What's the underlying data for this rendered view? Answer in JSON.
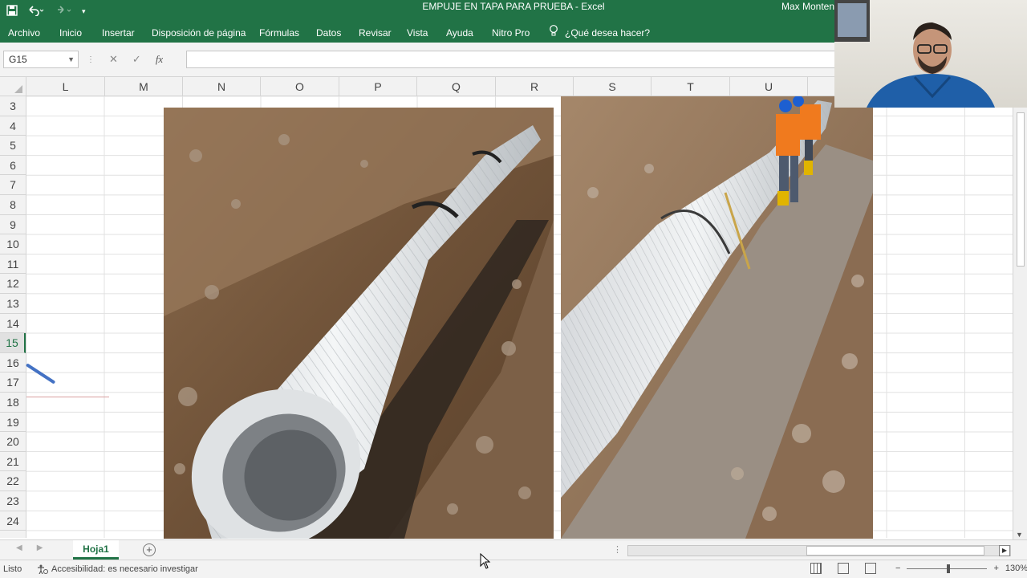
{
  "window": {
    "title": "EMPUJE EN TAPA PARA PRUEBA  -  Excel",
    "user": "Max Monten"
  },
  "ribbon": {
    "tabs": [
      "Archivo",
      "Inicio",
      "Insertar",
      "Disposición de página",
      "Fórmulas",
      "Datos",
      "Revisar",
      "Vista",
      "Ayuda",
      "Nitro Pro"
    ],
    "tell_me": "¿Qué desea hacer?"
  },
  "formula_bar": {
    "name_box": "G15",
    "fx_label": "fx",
    "value": ""
  },
  "columns": [
    "L",
    "M",
    "N",
    "O",
    "P",
    "Q",
    "R",
    "S",
    "T",
    "U"
  ],
  "rows": [
    "3",
    "4",
    "5",
    "6",
    "7",
    "8",
    "9",
    "10",
    "11",
    "12",
    "13",
    "14",
    "15",
    "16",
    "17",
    "18",
    "19",
    "20",
    "21",
    "22",
    "23",
    "24"
  ],
  "selected_row": "15",
  "sheets": [
    "Hoja1"
  ],
  "status": {
    "ready": "Listo",
    "accessibility": "Accesibilidad: es necesario investigar",
    "zoom": "130%"
  },
  "colors": {
    "excel_green": "#217346",
    "ink_blue": "#4472c4"
  }
}
